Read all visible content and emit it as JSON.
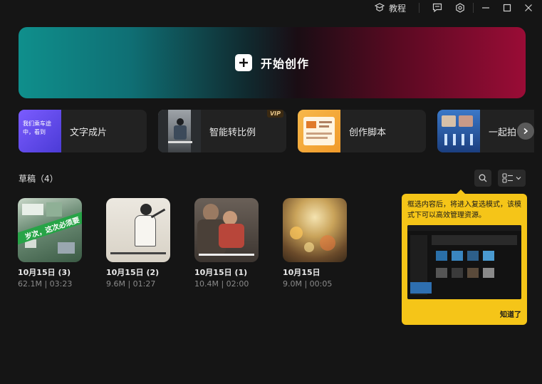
{
  "titlebar": {
    "tutorial_label": "教程",
    "icons": [
      "tutorial-icon",
      "feedback-icon",
      "settings-icon",
      "minimize-icon",
      "maximize-icon",
      "close-icon"
    ]
  },
  "hero": {
    "label": "开始创作"
  },
  "features": [
    {
      "label": "文字成片",
      "thumb_text": "我们乘车途中，看到",
      "vip": ""
    },
    {
      "label": "智能转比例",
      "vip": "VIP"
    },
    {
      "label": "创作脚本",
      "vip": ""
    },
    {
      "label": "一起拍",
      "vip": ""
    }
  ],
  "drafts": {
    "title": "草稿（4）",
    "items": [
      {
        "name": "10月15日 (3)",
        "meta": "62.1M | 03:23",
        "overlay_text": "岁次，这次必须要"
      },
      {
        "name": "10月15日 (2)",
        "meta": "9.6M | 01:27"
      },
      {
        "name": "10月15日 (1)",
        "meta": "10.4M | 02:00"
      },
      {
        "name": "10月15日",
        "meta": "9.0M | 00:05"
      }
    ]
  },
  "tooltip": {
    "text": "框选内容后，将进入复选模式，该模式下可以高效管理资源。",
    "button": "知道了"
  },
  "colors": {
    "tooltip_bg": "#f5c518",
    "hero_left": "#0f8f8c",
    "hero_right": "#9a0c36",
    "background": "#151515"
  }
}
